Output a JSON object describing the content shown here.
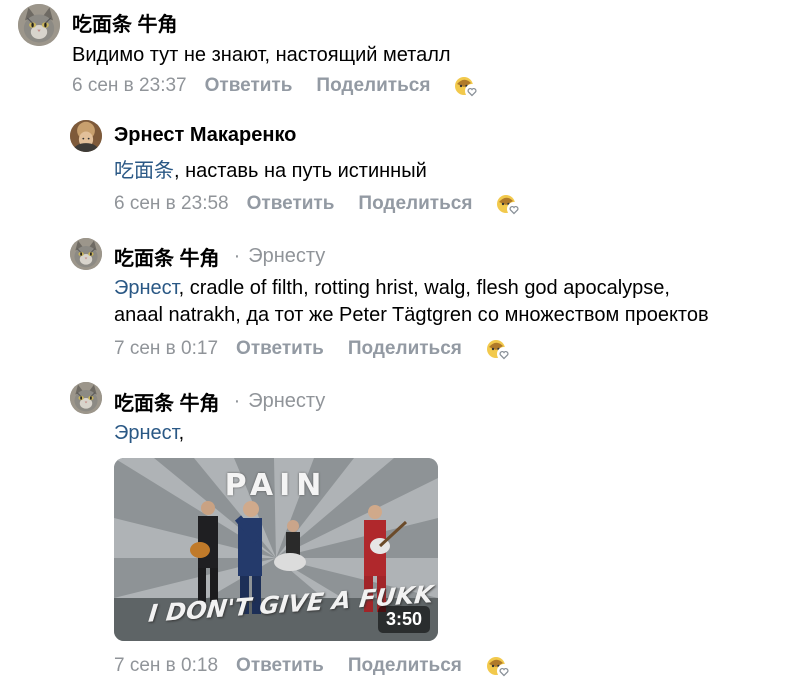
{
  "colors": {
    "text": "#000000",
    "meta": "#909499",
    "action": "#939aa3",
    "mention": "#2a5885"
  },
  "comments": [
    {
      "author": "吃面条 牛角",
      "text": "Видимо тут не знают, настоящий металл",
      "time": "6 сен в 23:37",
      "reply": "Ответить",
      "share": "Поделиться",
      "avatar_icon": "cat-avatar-icon",
      "reaction_icon": "reaction-emoji-icon"
    },
    {
      "author": "Эрнест Макаренко",
      "mention": "吃面条",
      "text": ", наставь на путь истинный",
      "time": "6 сен в 23:58",
      "reply": "Ответить",
      "share": "Поделиться",
      "avatar_icon": "user-photo-avatar-icon",
      "reaction_icon": "reaction-emoji-icon"
    },
    {
      "author": "吃面条 牛角",
      "reply_to": "Эрнесту",
      "mention": "Эрнест",
      "text_line1": ", cradle of filth, rotting hrist, walg, flesh god apocalypse,",
      "text_line2": "anaal natrakh, да тот же Peter Tägtgren со множеством проектов",
      "time": "7 сен в 0:17",
      "reply": "Ответить",
      "share": "Поделиться",
      "avatar_icon": "cat-avatar-icon",
      "reaction_icon": "reaction-emoji-icon"
    },
    {
      "author": "吃面条 牛角",
      "reply_to": "Эрнесту",
      "mention": "Эрнест",
      "text": ",",
      "video": {
        "band": "PAIN",
        "song": "I DON'T GIVE A FUKK",
        "duration": "3:50",
        "icon": "video-thumbnail-icon"
      },
      "time": "7 сен в 0:18",
      "reply": "Ответить",
      "share": "Поделиться",
      "avatar_icon": "cat-avatar-icon",
      "reaction_icon": "reaction-emoji-icon"
    }
  ],
  "separator": "·"
}
